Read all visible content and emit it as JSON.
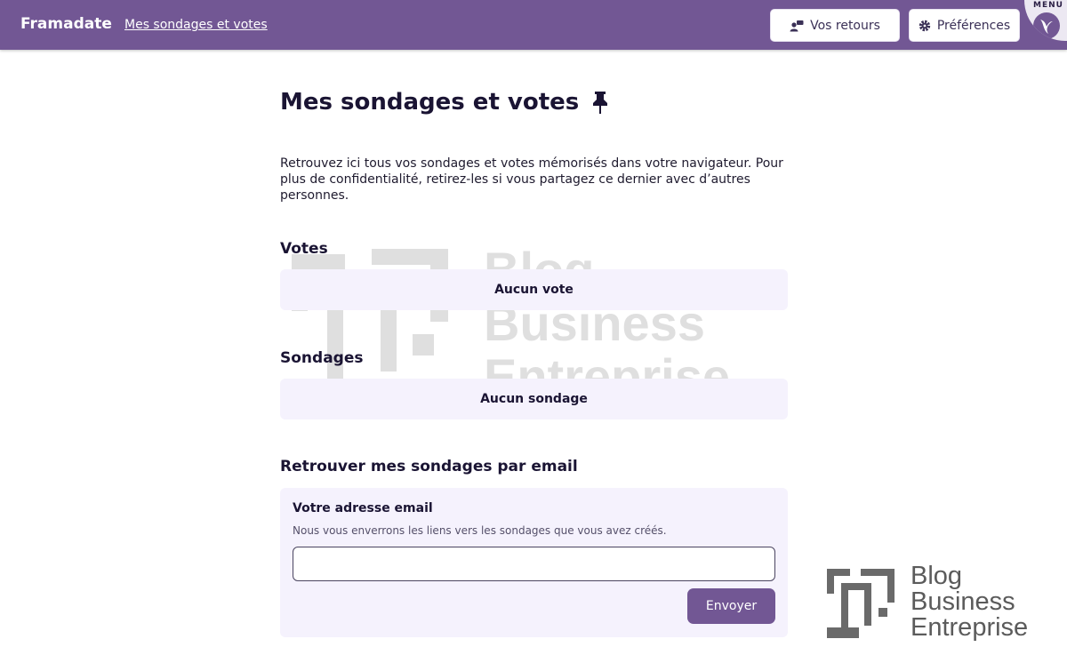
{
  "header": {
    "brand": "Framadate",
    "nav_link": "Mes sondages et votes",
    "retours_label": "Vos retours",
    "prefs_label": "Préférences",
    "menu_label": "MENU"
  },
  "page": {
    "title": "Mes sondages et votes",
    "intro": "Retrouvez ici tous vos sondages et votes mémorisés dans votre navigateur. Pour plus de confidentialité, retirez-les si vous partagez ce dernier avec d’autres personnes.",
    "votes_heading": "Votes",
    "votes_empty": "Aucun vote",
    "polls_heading": "Sondages",
    "polls_empty": "Aucun sondage",
    "email_heading": "Retrouver mes sondages par email",
    "email_label": "Votre adresse email",
    "email_help": "Nous vous enverrons les liens vers les sondages que vous avez créés.",
    "email_value": "",
    "send_label": "Envoyer"
  },
  "watermark": {
    "lines": [
      "Blog",
      "Business",
      "Entreprise"
    ]
  },
  "colors": {
    "brand": "#725794",
    "panel": "#f5f2fd"
  }
}
